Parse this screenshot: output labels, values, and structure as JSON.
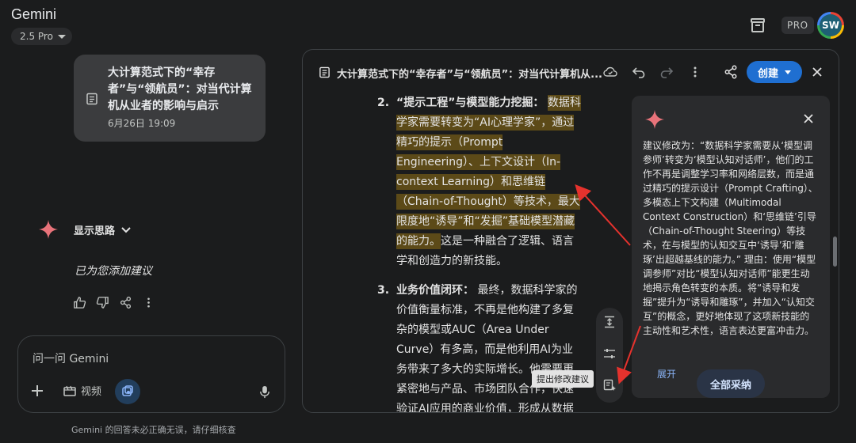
{
  "header": {
    "app_title": "Gemini",
    "model": "2.5 Pro",
    "pro_badge": "PRO",
    "avatar_initials": "SW"
  },
  "chat": {
    "doc_card": {
      "title": "大计算范式下的“幸存者”与“领航员”：对当代计算机从业者的影响与启示",
      "date": "6月26日 19:09"
    },
    "thoughts_label": "显示思路",
    "reply": "已为您添加建议"
  },
  "input": {
    "placeholder": "问一问 Gemini",
    "video_label": "视频"
  },
  "disclaimer": "Gemini 的回答未必正确无误，请仔细核查",
  "doc_panel": {
    "title": "大计算范式下的“幸存者”与“领航员”：对当代计算机从...",
    "create_label": "创建",
    "items": [
      {
        "num": "2.",
        "heading": "“提示工程”与模型能力挖掘：",
        "highlight": "数据科学家需要转变为“AI心理学家”，通过精巧的提示（Prompt Engineering）、上下文设计（In-context Learning）和思维链（Chain-of-Thought）等技术，最大限度地“诱导”和“发掘”基础模型潜藏的能力。",
        "rest": "这是一种融合了逻辑、语言学和创造力的新技能。"
      },
      {
        "num": "3.",
        "heading": "业务价值闭环：",
        "highlight": "",
        "rest": "最终，数据科学家的价值衡量标准，不再是他构建了多复杂的模型或AUC（Area Under Curve）有多高，而是他利用AI为业务带来了多大的实际增长。他需要更紧密地与产品、市场团队合作，快速验证AI应用的商业价值，形成从数据"
      }
    ],
    "tooltip": "提出修改建议",
    "suggestion": {
      "text": "建议修改为：“数据科学家需要从‘模型调参师’转变为‘模型认知对话师’，他们的工作不再是调整学习率和网络层数，而是通过精巧的提示设计（Prompt Crafting）、多模态上下文构建（Multimodal Context Construction）和‘思维链’引导（Chain-of-Thought Steering）等技术，在与模型的认知交互中‘诱导’和‘雕琢’出超越基线的能力。” 理由：使用“模型调参师”对比“模型认知对话师”能更生动地揭示角色转变的本质。将“诱导和发掘”提升为“诱导和雕琢”，并加入“认知交互”的概念，更好地体现了这项新技能的主动性和艺术性，语言表达更富冲击力。",
      "expand_label": "展开",
      "accept_all_label": "全部采纳"
    }
  },
  "colors": {
    "background": "#1b1c1d",
    "highlight": "#5c4a18",
    "accent_blue": "#1f6fd1",
    "arrow_red": "#e5322d"
  }
}
